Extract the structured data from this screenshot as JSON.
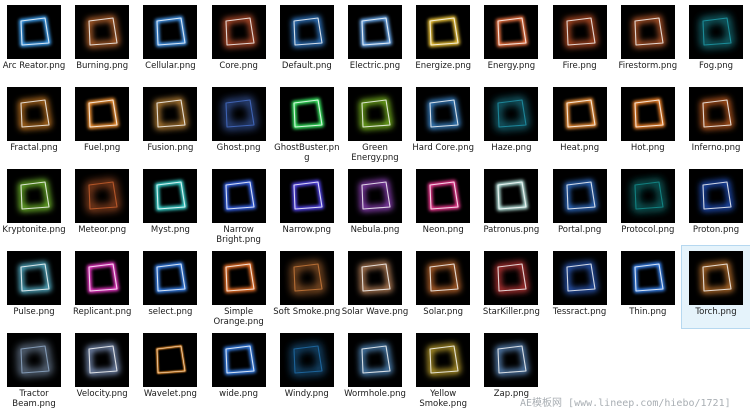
{
  "files": [
    {
      "name": "Arc Reator.png",
      "color": "#3fa9ff",
      "style": "clean"
    },
    {
      "name": "Burning.png",
      "color": "#ff8a3c",
      "style": "glow"
    },
    {
      "name": "Cellular.png",
      "color": "#4aa3ff",
      "style": "clean"
    },
    {
      "name": "Core.png",
      "color": "#ff6a3a",
      "style": "glow"
    },
    {
      "name": "Default.png",
      "color": "#3e9bff",
      "style": "bright"
    },
    {
      "name": "Electric.png",
      "color": "#6fb5ff",
      "style": "clean"
    },
    {
      "name": "Energize.png",
      "color": "#ffd23a",
      "style": "clean"
    },
    {
      "name": "Energy.png",
      "color": "#ff7a45",
      "style": "clean"
    },
    {
      "name": "Fire.png",
      "color": "#ff6a30",
      "style": "glow"
    },
    {
      "name": "Firestorm.png",
      "color": "#ff7a3a",
      "style": "glow"
    },
    {
      "name": "Fog.png",
      "color": "#28c7d8",
      "style": "soft"
    },
    {
      "name": "Fractal.png",
      "color": "#ff9a2a",
      "style": "glow"
    },
    {
      "name": "Fuel.png",
      "color": "#ff9a35",
      "style": "clean"
    },
    {
      "name": "Fusion.png",
      "color": "#ffb24a",
      "style": "glow"
    },
    {
      "name": "Ghost.png",
      "color": "#5a8cff",
      "style": "soft"
    },
    {
      "name": "GhostBuster.png",
      "color": "#3cff6a",
      "style": "clean"
    },
    {
      "name": "Green Energy.png",
      "color": "#a8ff2a",
      "style": "glow"
    },
    {
      "name": "Hard Core.png",
      "color": "#4aa8ff",
      "style": "bright"
    },
    {
      "name": "Haze.png",
      "color": "#2abcd8",
      "style": "soft"
    },
    {
      "name": "Heat.png",
      "color": "#ff9a3a",
      "style": "clean"
    },
    {
      "name": "Hot.png",
      "color": "#ff8a2a",
      "style": "clean"
    },
    {
      "name": "Inferno.png",
      "color": "#ff7a2a",
      "style": "glow"
    },
    {
      "name": "Kryptonite.png",
      "color": "#9aff3a",
      "style": "glow"
    },
    {
      "name": "Meteor.png",
      "color": "#ff7a3a",
      "style": "soft"
    },
    {
      "name": "Myst.png",
      "color": "#3ae6e0",
      "style": "clean"
    },
    {
      "name": "Narrow Bright.png",
      "color": "#3a6cff",
      "style": "clean"
    },
    {
      "name": "Narrow.png",
      "color": "#5a4cff",
      "style": "clean"
    },
    {
      "name": "Nebula.png",
      "color": "#c45aff",
      "style": "glow"
    },
    {
      "name": "Neon.png",
      "color": "#ff3a9a",
      "style": "clean"
    },
    {
      "name": "Patronus.png",
      "color": "#bff0e8",
      "style": "clean"
    },
    {
      "name": "Portal.png",
      "color": "#3a8cff",
      "style": "bright"
    },
    {
      "name": "Protocol.png",
      "color": "#1ab6b6",
      "style": "soft"
    },
    {
      "name": "Proton.png",
      "color": "#2a6cff",
      "style": "glow"
    },
    {
      "name": "Pulse.png",
      "color": "#6ae0ff",
      "style": "bright"
    },
    {
      "name": "Replicant.png",
      "color": "#ff3ad6",
      "style": "clean"
    },
    {
      "name": "select.png",
      "color": "#3a8cff",
      "style": "clean"
    },
    {
      "name": "Simple Orange.png",
      "color": "#ff7a2a",
      "style": "clean"
    },
    {
      "name": "Soft Smoke.png",
      "color": "#ff9a4a",
      "style": "soft"
    },
    {
      "name": "Solar Wave.png",
      "color": "#ffb27a",
      "style": "glow"
    },
    {
      "name": "Solar.png",
      "color": "#ff8a3a",
      "style": "glow"
    },
    {
      "name": "StarKiller.png",
      "color": "#ff4a4a",
      "style": "glow"
    },
    {
      "name": "Tessract.png",
      "color": "#3a7cff",
      "style": "glow"
    },
    {
      "name": "Thin.png",
      "color": "#3a8cff",
      "style": "clean"
    },
    {
      "name": "Torch.png",
      "color": "#ff9a3a",
      "style": "glow"
    },
    {
      "name": "Tractor Beam.png",
      "color": "#b8d8ff",
      "style": "soft"
    },
    {
      "name": "Velocity.png",
      "color": "#aac8ff",
      "style": "glow"
    },
    {
      "name": "Wavelet.png",
      "color": "#ff9a2a",
      "style": "thin"
    },
    {
      "name": "wide.png",
      "color": "#3a8cff",
      "style": "clean"
    },
    {
      "name": "Windy.png",
      "color": "#2a8cd8",
      "style": "soft"
    },
    {
      "name": "Wormhole.png",
      "color": "#6ab8ff",
      "style": "glow"
    },
    {
      "name": "Yellow Smoke.png",
      "color": "#ffd83a",
      "style": "glow"
    },
    {
      "name": "Zap.png",
      "color": "#7ab8ff",
      "style": "glow"
    }
  ],
  "selected_index": 43,
  "watermark": "AE模板网 [www.lineep.com/hiebo/1721]"
}
